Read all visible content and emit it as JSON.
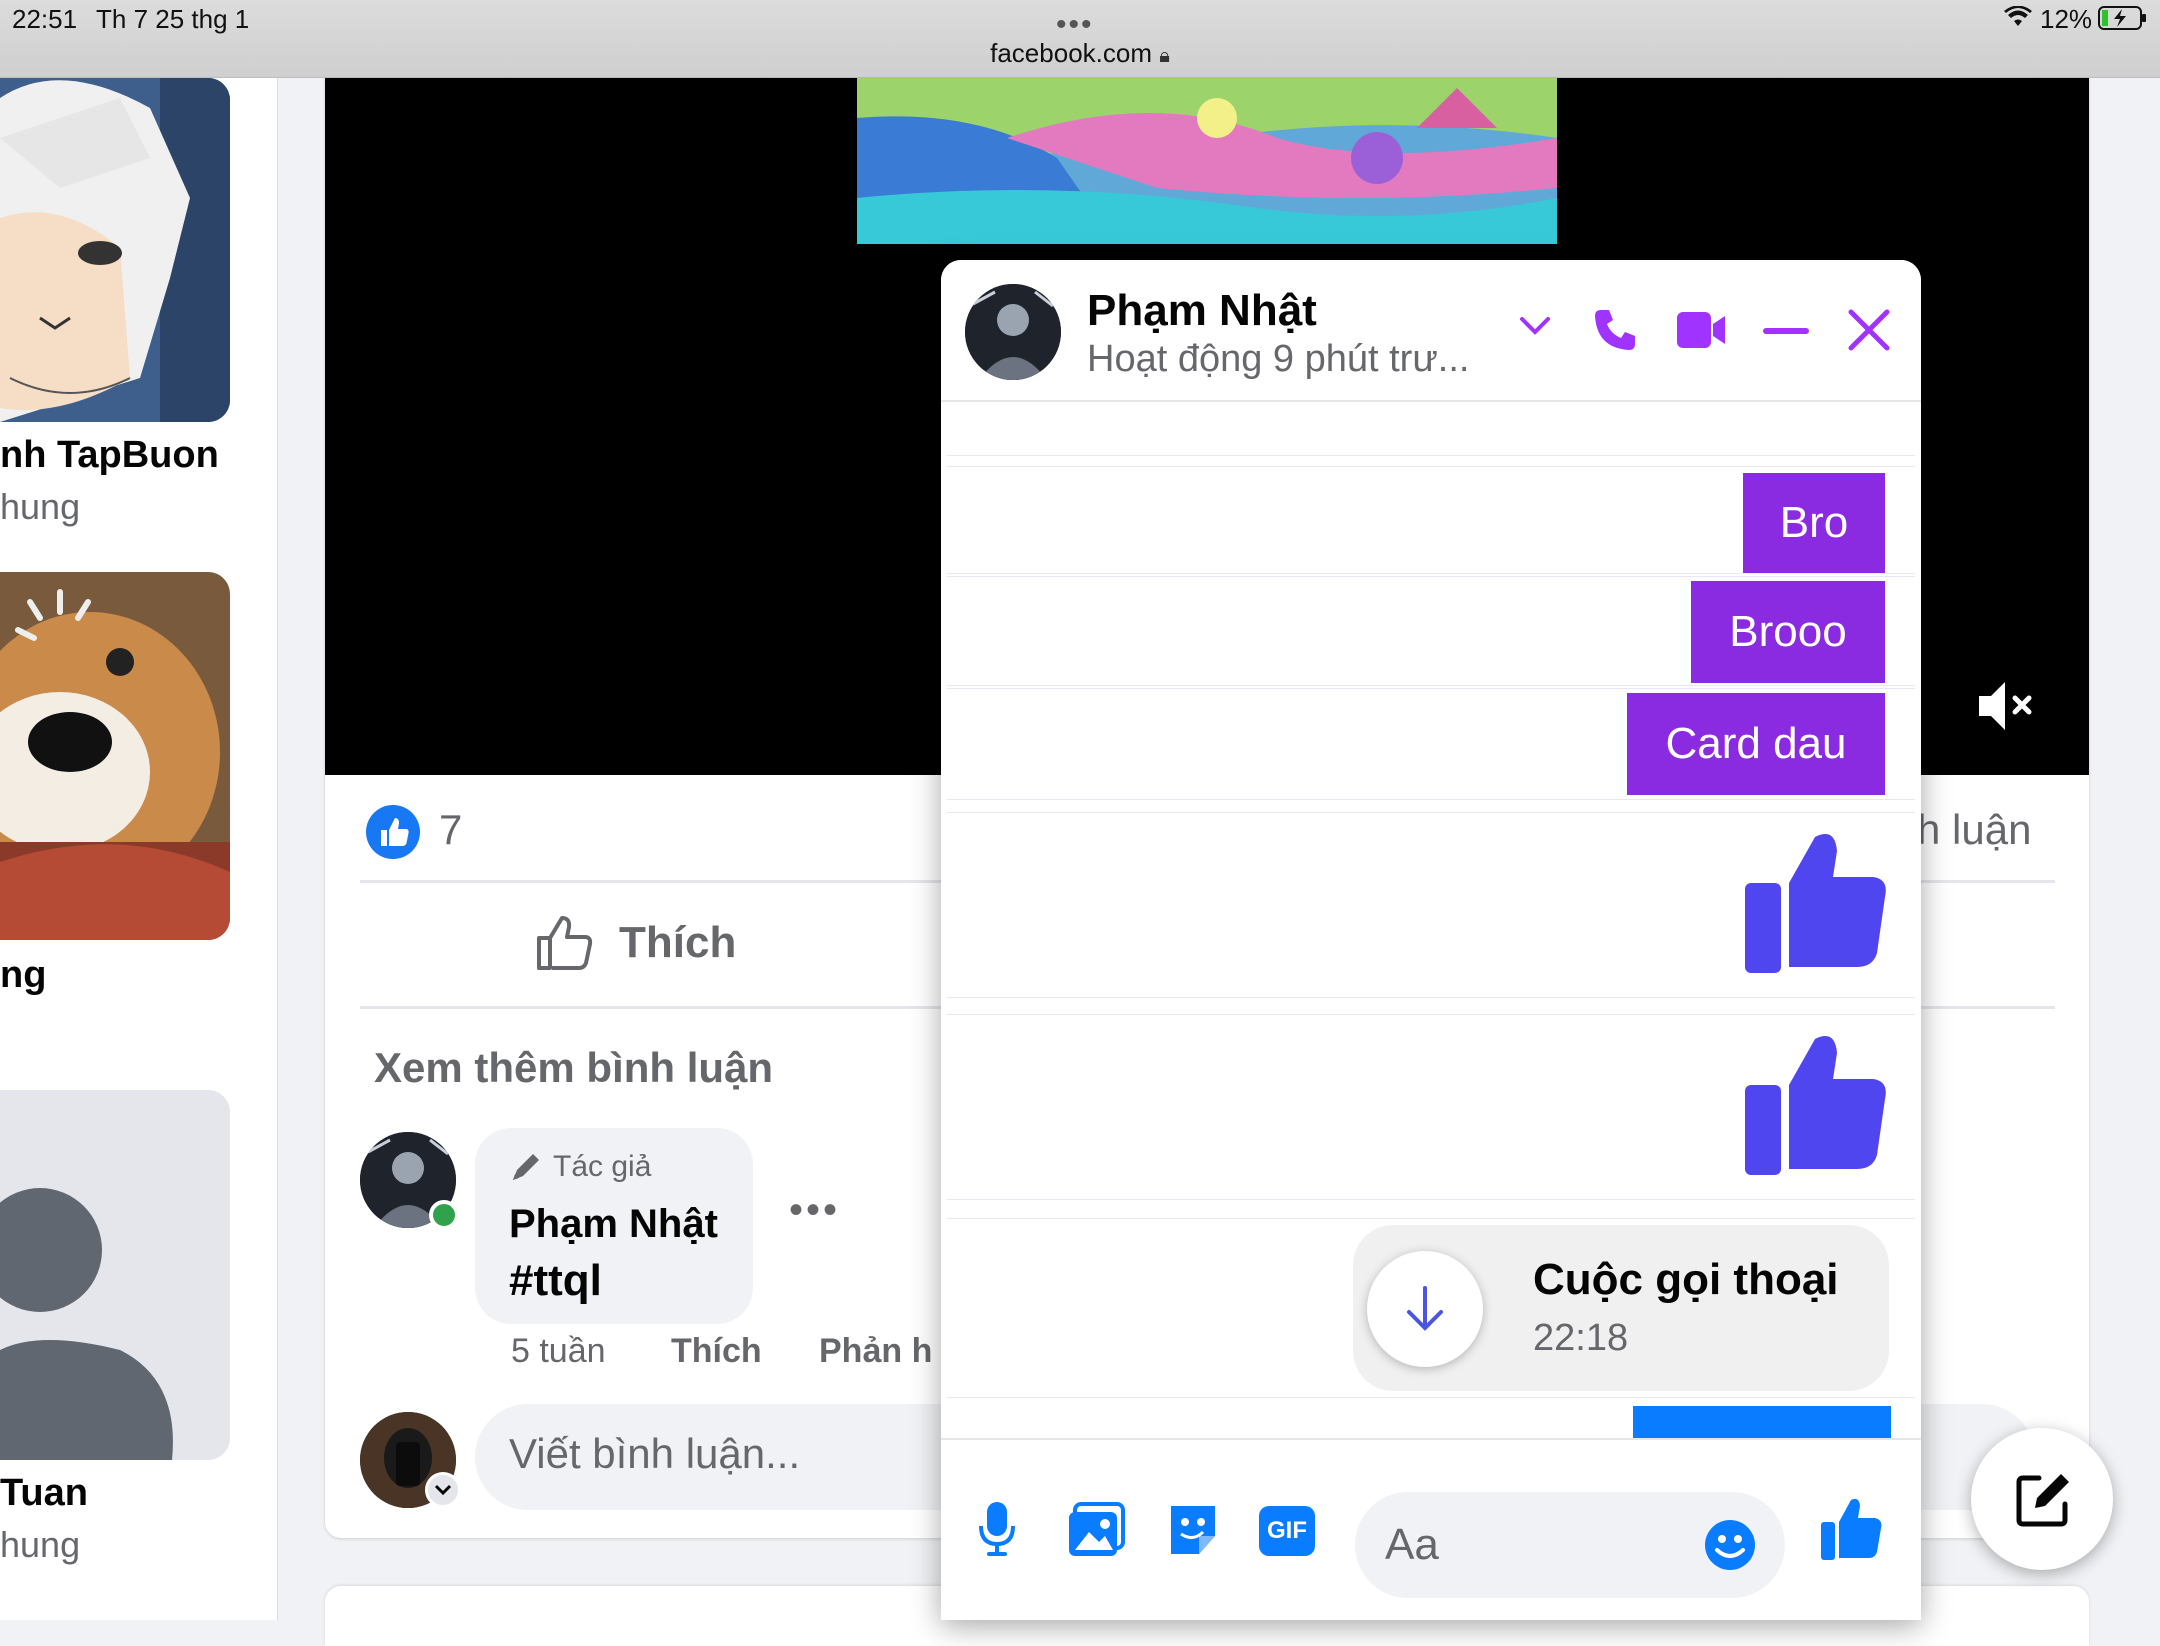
{
  "status": {
    "time": "22:51",
    "date": "Th 7 25 thg 1",
    "url": "facebook.com",
    "battery": "12%"
  },
  "left": {
    "items": [
      {
        "name": "nh TapBuon",
        "sub": "hung"
      },
      {
        "name": "ng",
        "sub": ""
      },
      {
        "name": "Tuan",
        "sub": "hung"
      }
    ]
  },
  "post": {
    "reaction_count": "7",
    "like_label": "Thích",
    "comment_partial": "h luận",
    "more_comments": "Xem thêm bình luận",
    "comment": {
      "badge": "Tác giả",
      "author": "Phạm Nhật",
      "text": "#ttql",
      "time": "5 tuần",
      "like": "Thích",
      "reply": "Phản h"
    },
    "write_placeholder": "Viết bình luận..."
  },
  "chat": {
    "name": "Phạm Nhật",
    "status": "Hoạt động 9 phút trư...",
    "messages": [
      "Bro",
      "Brooo",
      "Card dau"
    ],
    "call": {
      "title": "Cuộc gọi thoại",
      "time": "22:18"
    },
    "input_placeholder": "Aa",
    "accent": "#a033ff",
    "bubble_color": "#8a2be2",
    "like_color": "#5046f0"
  }
}
